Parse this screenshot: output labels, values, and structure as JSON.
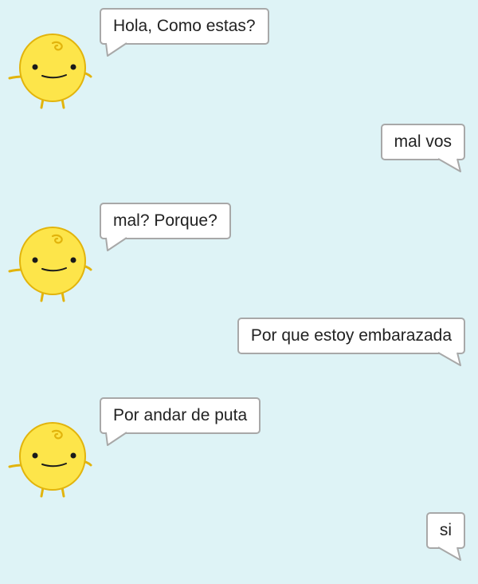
{
  "conversation": {
    "messages": [
      {
        "sender": "bot",
        "text": "Hola, Como estas?"
      },
      {
        "sender": "user",
        "text": "mal vos"
      },
      {
        "sender": "bot",
        "text": "mal? Porque?"
      },
      {
        "sender": "user",
        "text": "Por que estoy embarazada"
      },
      {
        "sender": "bot",
        "text": "Por andar de puta"
      },
      {
        "sender": "user",
        "text": "si"
      }
    ]
  },
  "theme": {
    "background": "#def3f6",
    "bubble_background": "#ffffff",
    "bubble_border": "#a8a8a8",
    "avatar_color": "#fde54a",
    "avatar_outline": "#e2b40c"
  }
}
